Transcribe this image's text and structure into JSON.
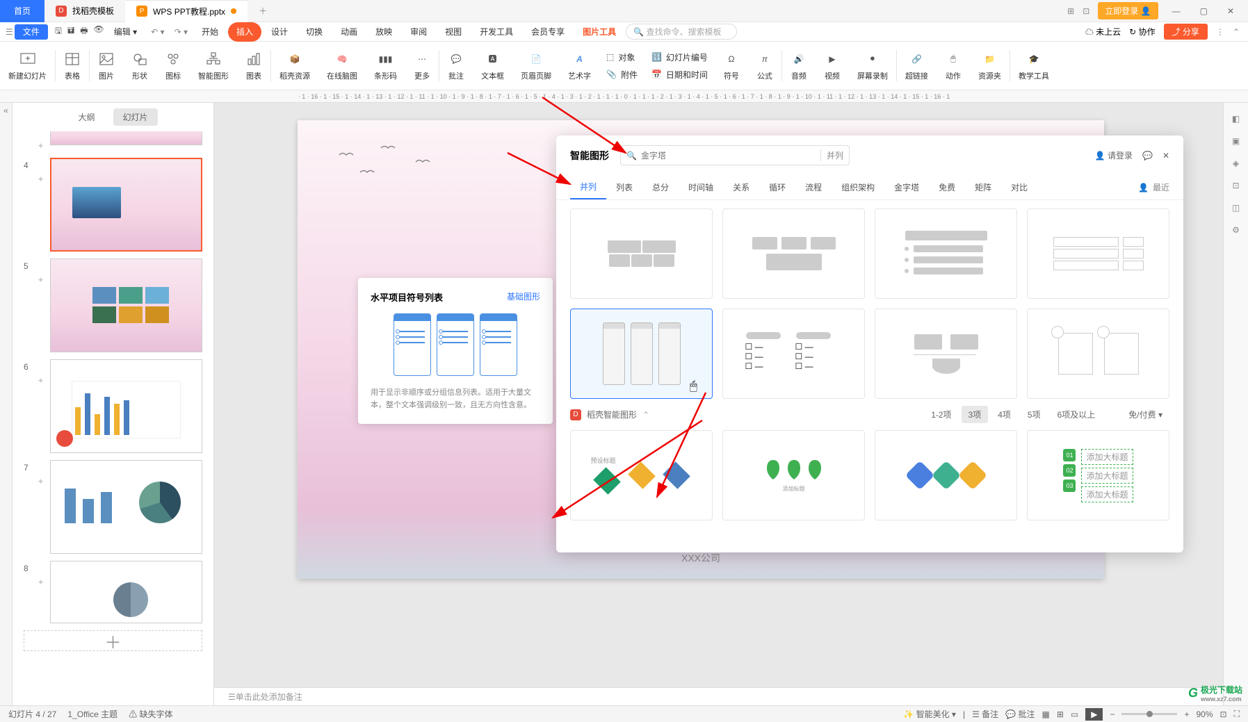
{
  "top": {
    "home": "首页",
    "tab1": "找稻壳模板",
    "tab2": "WPS PPT教程.pptx",
    "login": "立即登录"
  },
  "menu": {
    "file": "文件",
    "edit": "编辑",
    "items": [
      "开始",
      "插入",
      "设计",
      "切换",
      "动画",
      "放映",
      "审阅",
      "视图",
      "开发工具",
      "会员专享"
    ],
    "picture_tools": "图片工具",
    "search_ph": "查找命令、搜索模板",
    "cloud": "未上云",
    "coop": "协作",
    "share": "分享"
  },
  "ribbon": {
    "new_slide": "新建幻灯片",
    "table": "表格",
    "picture": "图片",
    "shape": "形状",
    "icon": "图标",
    "smart": "智能图形",
    "chart": "图表",
    "resource": "稻壳资源",
    "mindmap": "在线脑图",
    "barcode": "条形码",
    "more": "更多",
    "comment": "批注",
    "textbox": "文本框",
    "header": "页眉页脚",
    "wordart": "艺术字",
    "object": "对象",
    "attachment": "附件",
    "slidenum": "幻灯片编号",
    "datetime": "日期和时间",
    "symbol": "符号",
    "formula": "公式",
    "audio": "音频",
    "video": "视频",
    "screenrec": "屏幕录制",
    "hyperlink": "超链接",
    "action": "动作",
    "resource2": "资源夹",
    "teaching": "教学工具"
  },
  "panel": {
    "outline": "大纲",
    "slides": "幻灯片",
    "nums": [
      "4",
      "5",
      "6",
      "7",
      "8"
    ]
  },
  "slide": {
    "footer": "XXX公司"
  },
  "tooltip": {
    "title": "水平项目符号列表",
    "link": "基础图形",
    "desc": "用于显示非顺序或分组信息列表。适用于大量文本，整个文本强调级别一致，且无方向性含意。"
  },
  "popup": {
    "title": "智能图形",
    "search_ph": "金字塔",
    "search_btn": "并列",
    "login": "请登录",
    "tabs": [
      "并列",
      "列表",
      "总分",
      "时间轴",
      "关系",
      "循环",
      "流程",
      "组织架构",
      "金字塔",
      "免费",
      "矩阵",
      "对比"
    ],
    "recent": "最近",
    "section": "稻壳智能图形",
    "chips": [
      "1-2项",
      "3项",
      "4项",
      "5项",
      "6项及以上"
    ],
    "free_paid": "免/付费"
  },
  "notes": "单击此处添加备注",
  "status": {
    "slide": "幻灯片 4 / 27",
    "theme": "1_Office 主题",
    "fonts": "缺失字体",
    "beautify": "智能美化",
    "note": "备注",
    "comment": "批注",
    "zoom": "90%"
  },
  "ruler": "· 1 · 16 · 1 · 15 · 1 · 14 · 1 · 13 · 1 · 12 · 1 · 11 · 1 · 10 · 1 · 9 · 1 · 8 · 1 · 7 · 1 · 6 · 1 · 5 · 1 · 4 · 1 · 3 · 1 · 2 · 1 · 1 · 1 · 0 · 1 · 1 · 1 · 2 · 1 · 3 · 1 · 4 · 1 · 5 · 1 · 6 · 1 · 7 · 1 · 8 · 1 · 9 · 1 · 10 · 1 · 11 · 1 · 12 · 1 · 13 · 1 · 14 · 1 · 15 · 1 · 16 · 1",
  "watermark": {
    "brand": "极光下载站",
    "url": "www.xz7.com"
  }
}
